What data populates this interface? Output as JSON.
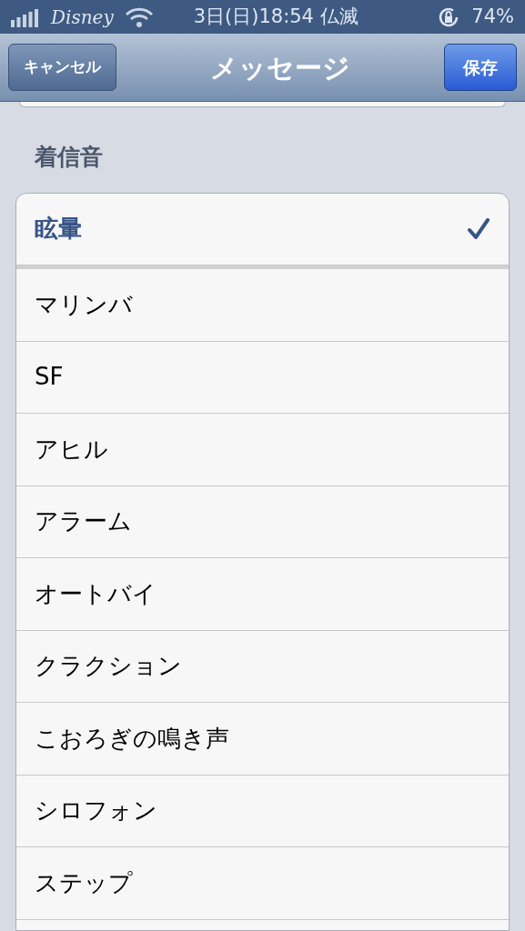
{
  "status_bar": {
    "carrier": "Disney",
    "time": "3日(日)18:54 仏滅",
    "battery": "74%"
  },
  "nav_bar": {
    "title": "メッセージ",
    "left_button": "キャンセル",
    "right_button": "保存"
  },
  "section": {
    "header": "着信音"
  },
  "custom_tones": [
    {
      "label": "眩暈",
      "selected": true
    }
  ],
  "tones": [
    {
      "label": "マリンバ",
      "selected": false
    },
    {
      "label": "SF",
      "selected": false
    },
    {
      "label": "アヒル",
      "selected": false
    },
    {
      "label": "アラーム",
      "selected": false
    },
    {
      "label": "オートバイ",
      "selected": false
    },
    {
      "label": "クラクション",
      "selected": false
    },
    {
      "label": "こおろぎの鳴き声",
      "selected": false
    },
    {
      "label": "シロフォン",
      "selected": false
    },
    {
      "label": "ステップ",
      "selected": false
    }
  ]
}
